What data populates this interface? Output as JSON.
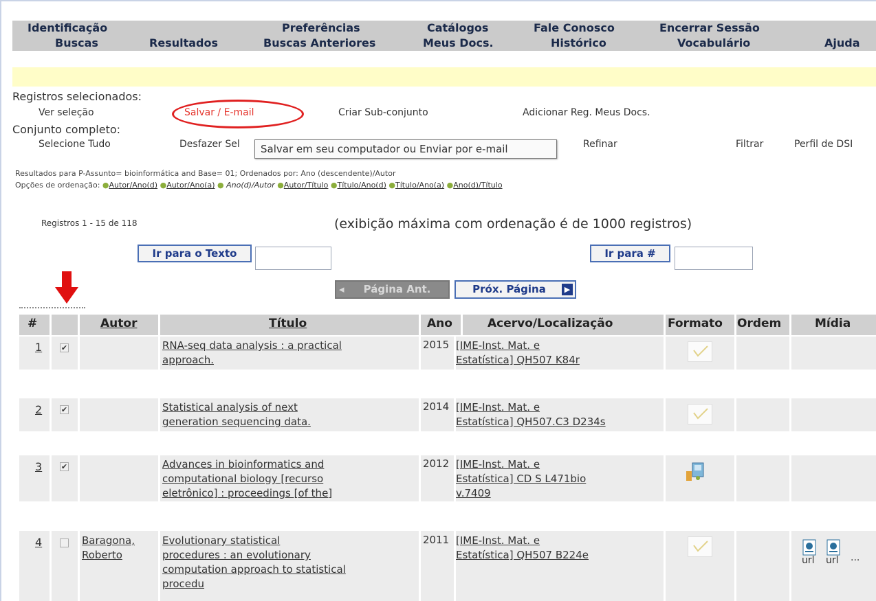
{
  "nav": {
    "row1": [
      "Identificação",
      "Preferências",
      "Catálogos",
      "Fale Conosco",
      "Encerrar Sessão"
    ],
    "row2": [
      "Buscas",
      "Resultados",
      "Buscas Anteriores",
      "Meus Docs.",
      "Histórico",
      "Vocabulário",
      "Ajuda"
    ]
  },
  "selected": {
    "heading": "Registros selecionados:",
    "ver": "Ver seleção",
    "salvar": "Salvar / E-mail",
    "criar": "Criar Sub-conjunto",
    "adicionar": "Adicionar Reg. Meus Docs."
  },
  "full": {
    "heading": "Conjunto completo:",
    "selecione": "Selecione Tudo",
    "desfazer": "Desfazer Sel",
    "refinar": "Refinar",
    "filtrar": "Filtrar",
    "perfil": "Perfil de DSI"
  },
  "tooltip": "Salvar em seu computador ou Enviar por e-mail",
  "results_line": "Resultados para P-Assunto= bioinformática and Base= 01; Ordenados por: Ano (descendente)/Autor",
  "sort": {
    "label": "Opções de ordenação:",
    "options": [
      "Autor/Ano(d)",
      "Autor/Ano(a)",
      "Ano(d)/Autor",
      "Autor/Título",
      "Título/Ano(d)",
      "Título/Ano(a)",
      "Ano(d)/Título"
    ]
  },
  "records_range": "Registros 1 - 15 de 118",
  "max_display": "(exibição máxima com ordenação é de 1000 registros)",
  "buttons": {
    "goto_text": "Ir para o Texto",
    "goto_num": "Ir para #",
    "prev": "Página Ant.",
    "next": "Próx. Página"
  },
  "table": {
    "headers": [
      "#",
      "Autor",
      "Título",
      "Ano",
      "Acervo/Localização",
      "Formato",
      "Ordem",
      "Mídia"
    ],
    "rows": [
      {
        "num": "1",
        "checked": true,
        "author": "",
        "title_lines": [
          "RNA-seq data analysis : a practical",
          "approach."
        ],
        "year": "2015",
        "loc_lines": [
          "[IME-Inst. Mat. e",
          "Estatística] QH507 K84r"
        ],
        "format": "book",
        "media": []
      },
      {
        "num": "2",
        "checked": true,
        "author": "",
        "title_lines": [
          "Statistical analysis of next",
          "generation sequencing data."
        ],
        "year": "2014",
        "loc_lines": [
          "[IME-Inst. Mat. e",
          "Estatística] QH507.C3 D234s"
        ],
        "format": "book",
        "media": []
      },
      {
        "num": "3",
        "checked": true,
        "author": "",
        "title_lines": [
          "Advances in bioinformatics and",
          "computational biology [recurso",
          "eletrônico] : proceedings [of the]"
        ],
        "year": "2012",
        "loc_lines": [
          "[IME-Inst. Mat. e",
          "Estatística] CD S L471bio",
          "v.7409"
        ],
        "format": "electronic",
        "media": []
      },
      {
        "num": "4",
        "checked": false,
        "author_lines": [
          "Baragona,",
          "Roberto"
        ],
        "title_lines": [
          "Evolutionary statistical",
          "procedures : an evolutionary",
          "computation approach to statistical",
          "procedu"
        ],
        "year": "2011",
        "loc_lines": [
          "[IME-Inst. Mat. e",
          "Estatística] QH507 B224e"
        ],
        "format": "book",
        "media": [
          "url",
          "url",
          "···"
        ]
      }
    ]
  }
}
